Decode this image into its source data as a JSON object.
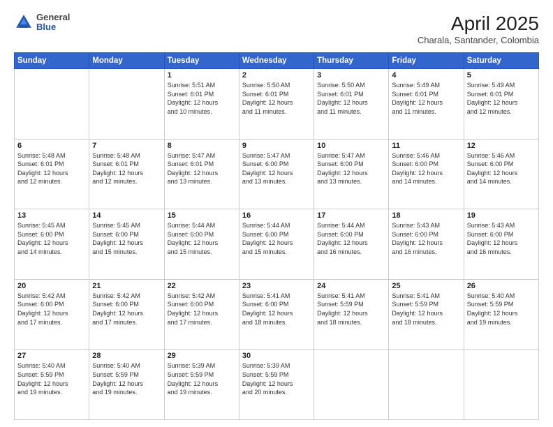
{
  "header": {
    "logo": {
      "general": "General",
      "blue": "Blue"
    },
    "title": "April 2025",
    "location": "Charala, Santander, Colombia"
  },
  "weekdays": [
    "Sunday",
    "Monday",
    "Tuesday",
    "Wednesday",
    "Thursday",
    "Friday",
    "Saturday"
  ],
  "weeks": [
    [
      {
        "day": "",
        "info": ""
      },
      {
        "day": "",
        "info": ""
      },
      {
        "day": "1",
        "info": "Sunrise: 5:51 AM\nSunset: 6:01 PM\nDaylight: 12 hours\nand 10 minutes."
      },
      {
        "day": "2",
        "info": "Sunrise: 5:50 AM\nSunset: 6:01 PM\nDaylight: 12 hours\nand 11 minutes."
      },
      {
        "day": "3",
        "info": "Sunrise: 5:50 AM\nSunset: 6:01 PM\nDaylight: 12 hours\nand 11 minutes."
      },
      {
        "day": "4",
        "info": "Sunrise: 5:49 AM\nSunset: 6:01 PM\nDaylight: 12 hours\nand 11 minutes."
      },
      {
        "day": "5",
        "info": "Sunrise: 5:49 AM\nSunset: 6:01 PM\nDaylight: 12 hours\nand 12 minutes."
      }
    ],
    [
      {
        "day": "6",
        "info": "Sunrise: 5:48 AM\nSunset: 6:01 PM\nDaylight: 12 hours\nand 12 minutes."
      },
      {
        "day": "7",
        "info": "Sunrise: 5:48 AM\nSunset: 6:01 PM\nDaylight: 12 hours\nand 12 minutes."
      },
      {
        "day": "8",
        "info": "Sunrise: 5:47 AM\nSunset: 6:01 PM\nDaylight: 12 hours\nand 13 minutes."
      },
      {
        "day": "9",
        "info": "Sunrise: 5:47 AM\nSunset: 6:00 PM\nDaylight: 12 hours\nand 13 minutes."
      },
      {
        "day": "10",
        "info": "Sunrise: 5:47 AM\nSunset: 6:00 PM\nDaylight: 12 hours\nand 13 minutes."
      },
      {
        "day": "11",
        "info": "Sunrise: 5:46 AM\nSunset: 6:00 PM\nDaylight: 12 hours\nand 14 minutes."
      },
      {
        "day": "12",
        "info": "Sunrise: 5:46 AM\nSunset: 6:00 PM\nDaylight: 12 hours\nand 14 minutes."
      }
    ],
    [
      {
        "day": "13",
        "info": "Sunrise: 5:45 AM\nSunset: 6:00 PM\nDaylight: 12 hours\nand 14 minutes."
      },
      {
        "day": "14",
        "info": "Sunrise: 5:45 AM\nSunset: 6:00 PM\nDaylight: 12 hours\nand 15 minutes."
      },
      {
        "day": "15",
        "info": "Sunrise: 5:44 AM\nSunset: 6:00 PM\nDaylight: 12 hours\nand 15 minutes."
      },
      {
        "day": "16",
        "info": "Sunrise: 5:44 AM\nSunset: 6:00 PM\nDaylight: 12 hours\nand 15 minutes."
      },
      {
        "day": "17",
        "info": "Sunrise: 5:44 AM\nSunset: 6:00 PM\nDaylight: 12 hours\nand 16 minutes."
      },
      {
        "day": "18",
        "info": "Sunrise: 5:43 AM\nSunset: 6:00 PM\nDaylight: 12 hours\nand 16 minutes."
      },
      {
        "day": "19",
        "info": "Sunrise: 5:43 AM\nSunset: 6:00 PM\nDaylight: 12 hours\nand 16 minutes."
      }
    ],
    [
      {
        "day": "20",
        "info": "Sunrise: 5:42 AM\nSunset: 6:00 PM\nDaylight: 12 hours\nand 17 minutes."
      },
      {
        "day": "21",
        "info": "Sunrise: 5:42 AM\nSunset: 6:00 PM\nDaylight: 12 hours\nand 17 minutes."
      },
      {
        "day": "22",
        "info": "Sunrise: 5:42 AM\nSunset: 6:00 PM\nDaylight: 12 hours\nand 17 minutes."
      },
      {
        "day": "23",
        "info": "Sunrise: 5:41 AM\nSunset: 6:00 PM\nDaylight: 12 hours\nand 18 minutes."
      },
      {
        "day": "24",
        "info": "Sunrise: 5:41 AM\nSunset: 5:59 PM\nDaylight: 12 hours\nand 18 minutes."
      },
      {
        "day": "25",
        "info": "Sunrise: 5:41 AM\nSunset: 5:59 PM\nDaylight: 12 hours\nand 18 minutes."
      },
      {
        "day": "26",
        "info": "Sunrise: 5:40 AM\nSunset: 5:59 PM\nDaylight: 12 hours\nand 19 minutes."
      }
    ],
    [
      {
        "day": "27",
        "info": "Sunrise: 5:40 AM\nSunset: 5:59 PM\nDaylight: 12 hours\nand 19 minutes."
      },
      {
        "day": "28",
        "info": "Sunrise: 5:40 AM\nSunset: 5:59 PM\nDaylight: 12 hours\nand 19 minutes."
      },
      {
        "day": "29",
        "info": "Sunrise: 5:39 AM\nSunset: 5:59 PM\nDaylight: 12 hours\nand 19 minutes."
      },
      {
        "day": "30",
        "info": "Sunrise: 5:39 AM\nSunset: 5:59 PM\nDaylight: 12 hours\nand 20 minutes."
      },
      {
        "day": "",
        "info": ""
      },
      {
        "day": "",
        "info": ""
      },
      {
        "day": "",
        "info": ""
      }
    ]
  ]
}
